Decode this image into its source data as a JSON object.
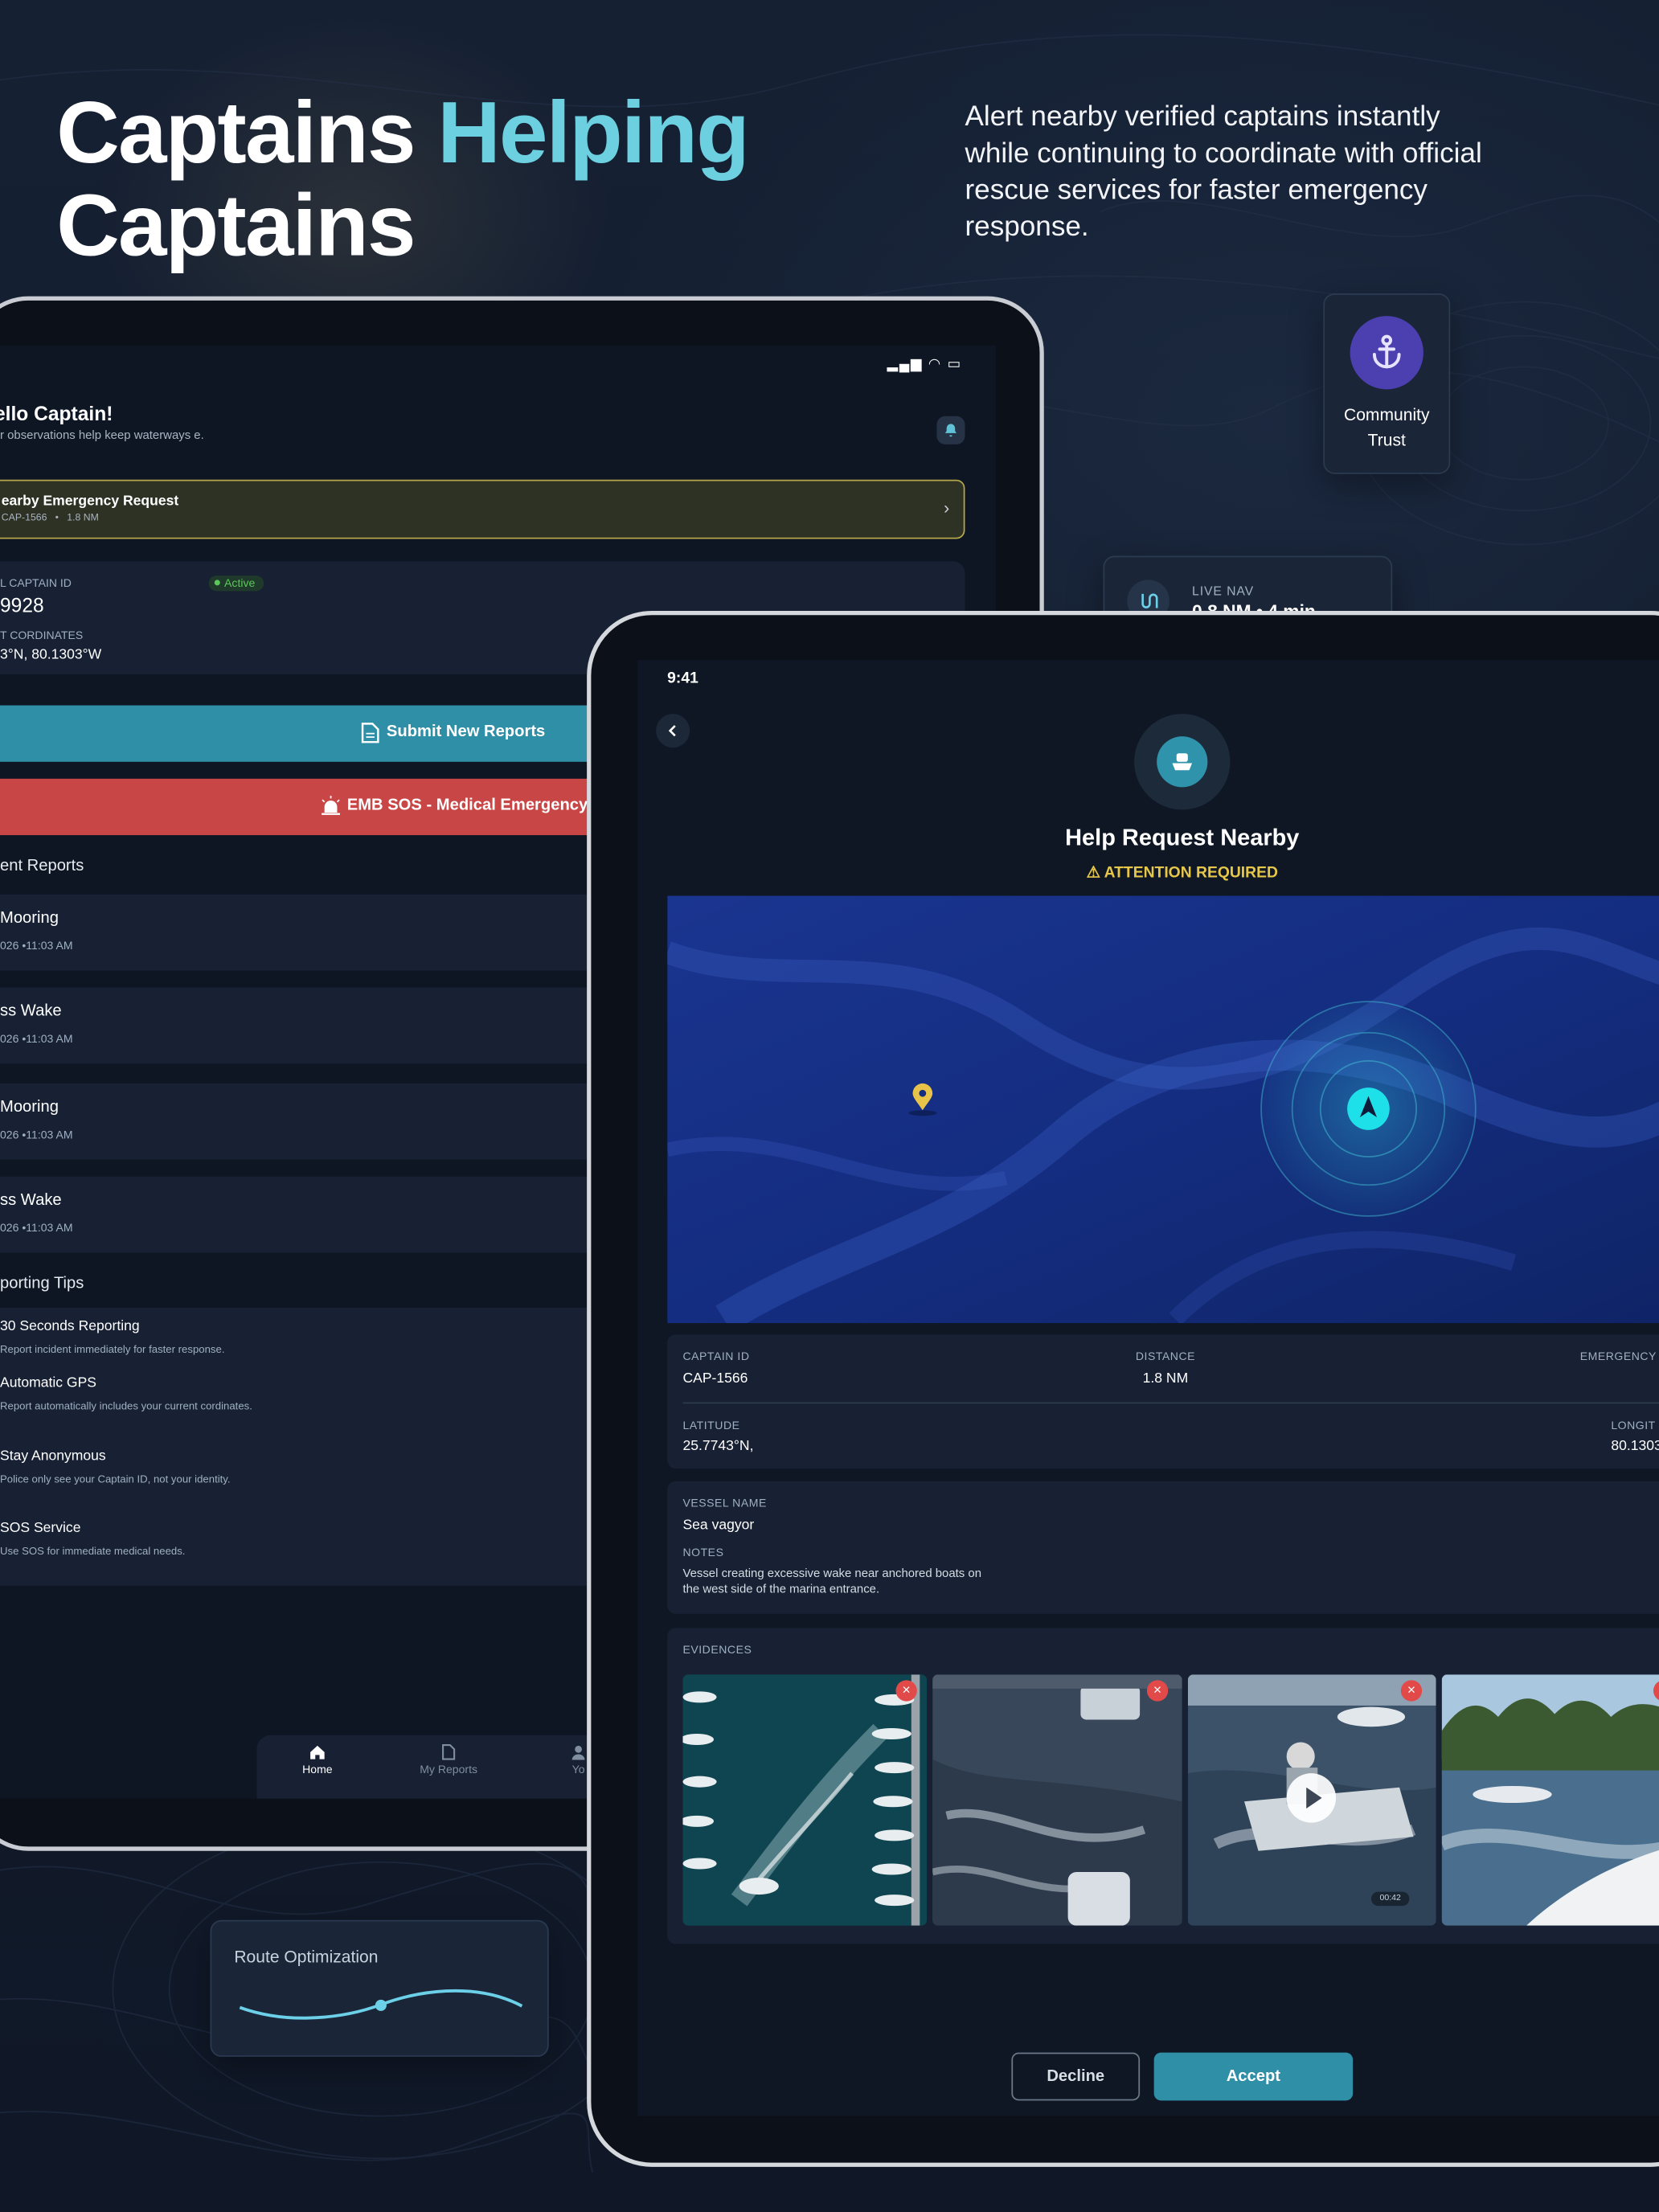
{
  "hero": {
    "title_white": "Captains",
    "title_accent": "Helping",
    "title_line2": "Captains",
    "subtitle": "Alert nearby verified captains instantly while continuing to coordinate with official rescue services for faster emergency response.",
    "accent_color": "#6cd0e0"
  },
  "badges": {
    "community_trust": {
      "line1": "Community",
      "line2": "Trust",
      "icon": "anchor-icon"
    },
    "live_nav": {
      "label": "LIVE NAV",
      "value": "0.8 NM • 4 min",
      "icon": "route-icon"
    },
    "route_optimization": {
      "label": "Route Optimization"
    }
  },
  "home_screen": {
    "greeting": "ello Captain!",
    "greeting_sub": "r observations help keep waterways e.",
    "emergency_banner": {
      "title": "earby Emergency Request",
      "captain": "CAP-1566",
      "distance": "1.8 NM"
    },
    "captain_id_label": "L CAPTAIN ID",
    "captain_id_value": "9928",
    "status": "Active",
    "coords_label": "T CORDINATES",
    "coords_value": "3°N,   80.1303°W",
    "submit_button": "Submit New Reports",
    "sos_button": "EMB SOS - Medical Emergency",
    "recent_heading": "ent Reports",
    "reports": [
      {
        "title": "Mooring",
        "meta": "026   •11:03 AM"
      },
      {
        "title": "ss Wake",
        "meta": "026   •11:03 AM"
      },
      {
        "title": "Mooring",
        "meta": "026   •11:03 AM"
      },
      {
        "title": "ss Wake",
        "meta": "026   •11:03 AM"
      }
    ],
    "tips_heading": "porting Tips",
    "tips": [
      {
        "title": "30 Seconds Reporting",
        "desc": "Report incident immediately for faster response."
      },
      {
        "title": "Automatic GPS",
        "desc": "Report automatically includes your current cordinates."
      },
      {
        "title": "Stay Anonymous",
        "desc": "Police only see your Captain ID, not your identity."
      },
      {
        "title": "SOS Service",
        "desc": "Use SOS for immediate medical needs."
      }
    ],
    "tabs": [
      {
        "label": "Home",
        "icon": "home-icon"
      },
      {
        "label": "My Reports",
        "icon": "document-icon"
      },
      {
        "label": "Yo",
        "icon": "person-icon"
      }
    ]
  },
  "help_screen": {
    "time": "9:41",
    "title": "Help Request Nearby",
    "attention": "ATTENTION REQUIRED",
    "captain_id_label": "CAPTAIN ID",
    "captain_id": "CAP-1566",
    "distance_label": "DISTANCE",
    "distance": "1.8 NM",
    "emergency_label": "EMERGENCY T",
    "latitude_label": "LATITUDE",
    "latitude": "25.7743°N,",
    "longitude_label": "LONGIT",
    "longitude": "80.1303",
    "vessel_label": "VESSEL NAME",
    "vessel": "Sea vagyor",
    "notes_label": "NOTES",
    "notes": "Vessel creating excessive wake near anchored boats on the west side of the marina entrance.",
    "evidences_label": "EVIDENCES",
    "video_duration": "00:42",
    "decline": "Decline",
    "accept": "Accept"
  }
}
